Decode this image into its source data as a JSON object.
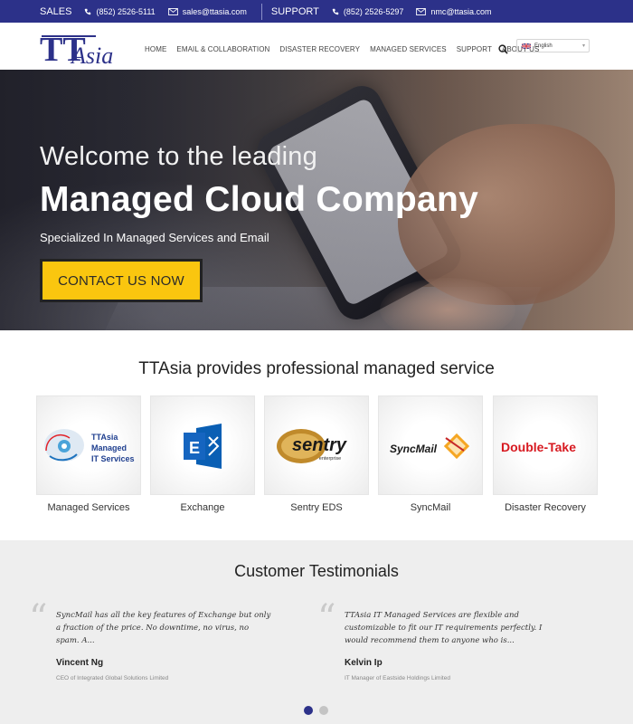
{
  "topbar": {
    "sales_label": "SALES",
    "sales_phone": "(852) 2526-5111",
    "sales_email": "sales@ttasia.com",
    "support_label": "SUPPORT",
    "support_phone": "(852) 2526-5297",
    "support_email": "nmc@ttasia.com"
  },
  "header": {
    "logo_tt": "TT",
    "logo_asia": "Asia",
    "nav": [
      "HOME",
      "EMAIL & COLLABORATION",
      "DISASTER RECOVERY",
      "MANAGED SERVICES",
      "SUPPORT",
      "ABOUT US"
    ],
    "language": "English"
  },
  "hero": {
    "line1": "Welcome to the leading",
    "line2": "Managed Cloud Company",
    "subtitle": "Specialized In Managed Services and Email",
    "cta": "CONTACT US NOW"
  },
  "services": {
    "heading": "TTAsia provides professional managed service",
    "items": [
      {
        "caption": "Managed Services",
        "logo_text": [
          "TTAsia",
          "Managed",
          "IT Services"
        ],
        "icon": "cloud-gear-icon"
      },
      {
        "caption": "Exchange",
        "logo_text": [],
        "icon": "exchange-logo"
      },
      {
        "caption": "Sentry EDS",
        "logo_text": [
          "sentry",
          "enterprise"
        ],
        "icon": "sentry-logo"
      },
      {
        "caption": "SyncMail",
        "logo_text": [
          "SyncMail"
        ],
        "icon": "syncmail-logo"
      },
      {
        "caption": "Disaster Recovery",
        "logo_text": [
          "Double-Take"
        ],
        "icon": "double-take-logo"
      }
    ]
  },
  "testimonials": {
    "heading": "Customer Testimonials",
    "items": [
      {
        "quote": "SyncMail has all the key features of Exchange but only a fraction of the price. No downtime, no virus, no spam. A...",
        "name": "Vincent Ng",
        "role": "CEO of Integrated Global Solutions Limited"
      },
      {
        "quote": "TTAsia IT Managed Services are flexible and customizable to fit our IT requirements perfectly. I would recommend them to anyone who is...",
        "name": "Kelvin Ip",
        "role": "IT Manager of Eastside Holdings Limited"
      }
    ],
    "active_slide": 1,
    "total_slides": 2
  },
  "colors": {
    "brand_navy": "#2c3189",
    "cta_yellow": "#fac60f",
    "dot_active": "#2c3189",
    "dot_inactive": "#c4c4c4",
    "sentry_gold": "#c08a2b",
    "double_take_red": "#d71920"
  }
}
